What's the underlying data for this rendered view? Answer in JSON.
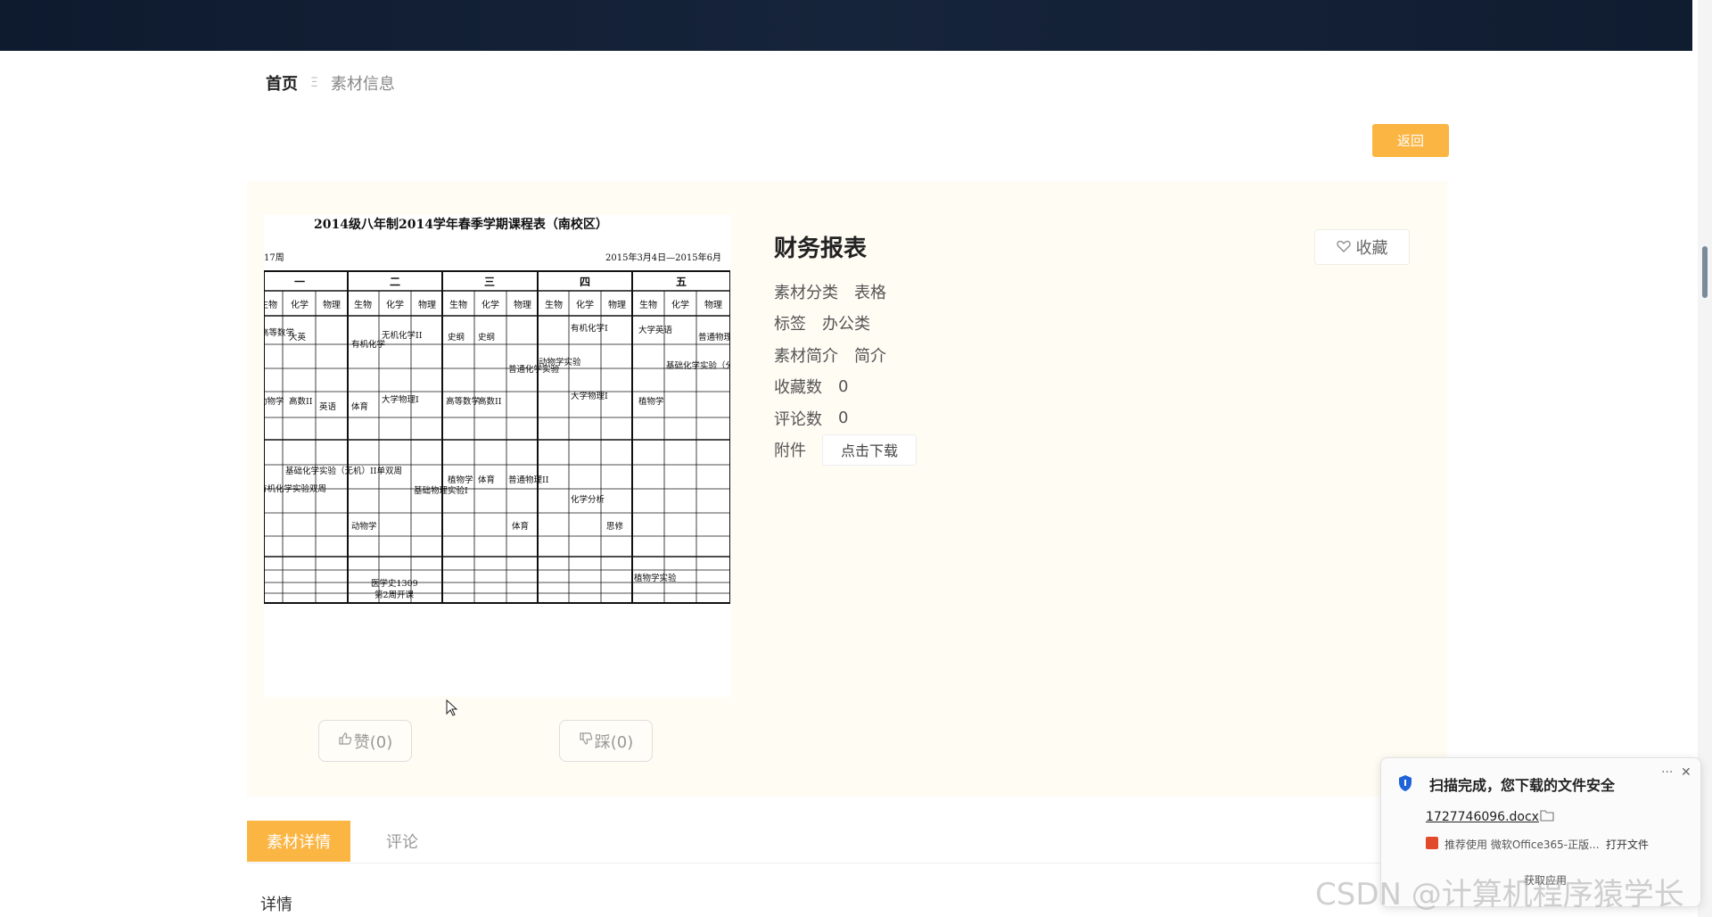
{
  "breadcrumb": {
    "home": "首页",
    "separator": "Ξ",
    "current": "素材信息"
  },
  "back_label": "返回",
  "material": {
    "title": "财务报表",
    "category_label": "素材分类",
    "category": "表格",
    "tags_label": "标签",
    "tags": "办公类",
    "intro_label": "素材简介",
    "intro": "简介",
    "favorites_label": "收藏数",
    "favorites": "0",
    "comments_label": "评论数",
    "comments": "0",
    "attachment_label": "附件",
    "download_label": "点击下载"
  },
  "favorite_label": "收藏",
  "votes": {
    "like": "赞(0)",
    "dislike": "踩(0)"
  },
  "tabs": [
    "素材详情",
    "评论"
  ],
  "details_label": "详情",
  "preview": {
    "title": "2014级八年制2014学年春季学期课程表（南校区）",
    "week": "17周",
    "date_range": "2015年3月4日—2015年6月",
    "days": [
      "一",
      "二",
      "三",
      "四",
      "五"
    ],
    "subjects": [
      "生物",
      "化学",
      "物理"
    ],
    "cells": [
      "高等数学",
      "大英",
      "有机化学",
      "无机化学II",
      "史纲",
      "史纲",
      "普通化学实验",
      "动物学实验",
      "有机化学I",
      "大学英语",
      "普通物理II",
      "动物学",
      "高数II",
      "英语",
      "体育",
      "大学物理I",
      "高等数学",
      "高数II",
      "大学物理I",
      "植物学",
      "基础化学实验（分析）单双周",
      "有机化学实验双周",
      "基础化学实验（无机）II单双周",
      "基础物理实验I",
      "植物学",
      "体育",
      "普通物理II",
      "化学分析",
      "动物学",
      "体育",
      "思修",
      "医学史1309",
      "第2周开课",
      "植物学实验"
    ]
  },
  "toast": {
    "title": "扫描完成，您下载的文件安全",
    "more": "···",
    "close": "✕",
    "filename": "1727746096.docx",
    "recommend": "推荐使用 微软Office365-正版...",
    "open": "打开文件",
    "get_app": "获取应用"
  },
  "watermark": "CSDN @计算机程序猿学长",
  "colors": {
    "accent": "#fbb543",
    "topbar": "#101c30",
    "panel": "#fffcf4"
  },
  "icons": [
    "heart-outline-icon",
    "thumbs-up-icon",
    "thumbs-down-icon",
    "shield-icon",
    "folder-icon",
    "close-icon",
    "cursor-icon"
  ]
}
